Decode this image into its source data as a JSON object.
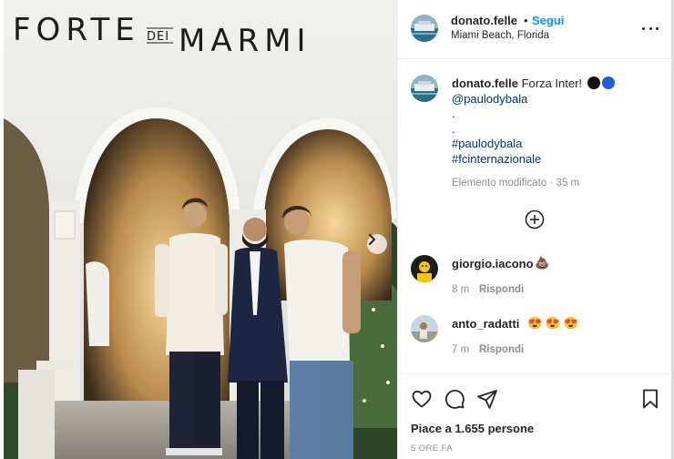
{
  "photo": {
    "sign_text_left": "FORTE",
    "sign_text_mid": "DEI",
    "sign_text_right": "MARMI",
    "next_icon": "chevron-right-icon"
  },
  "post_header": {
    "username": "donato.felle",
    "separator": "•",
    "follow_label": "Segui",
    "location": "Miami Beach, Florida",
    "more_icon": "more-horizontal-icon"
  },
  "caption": {
    "username": "donato.felle",
    "text": "Forza Inter!",
    "emoji_colors": [
      "#111111",
      "#1f5fd6"
    ],
    "mention": "@paulodybala",
    "dot1": ".",
    "dot2": ".",
    "hashtag1": "#paulodybala",
    "hashtag2": "#fcinternazionale",
    "edited_label": "Elemento modificato",
    "meta_sep": "·",
    "time": "35 m"
  },
  "load_more_icon": "plus-circle-icon",
  "comments": [
    {
      "username": "giorgio.iacono",
      "text": "💩",
      "time": "8 m",
      "reply_label": "Rispondi"
    },
    {
      "username": "anto_radatti",
      "text": "😍 😍 😍",
      "time": "7 m",
      "reply_label": "Rispondi"
    }
  ],
  "actions": {
    "like_icon": "heart-icon",
    "comment_icon": "comment-icon",
    "share_icon": "share-icon",
    "save_icon": "bookmark-icon",
    "likes_text": "Piace a 1.655 persone",
    "posted_ago": "5 ORE FA"
  },
  "colors": {
    "accent": "#0095f6",
    "text": "#262626",
    "muted": "#8e8e8e",
    "link": "#00376b"
  }
}
